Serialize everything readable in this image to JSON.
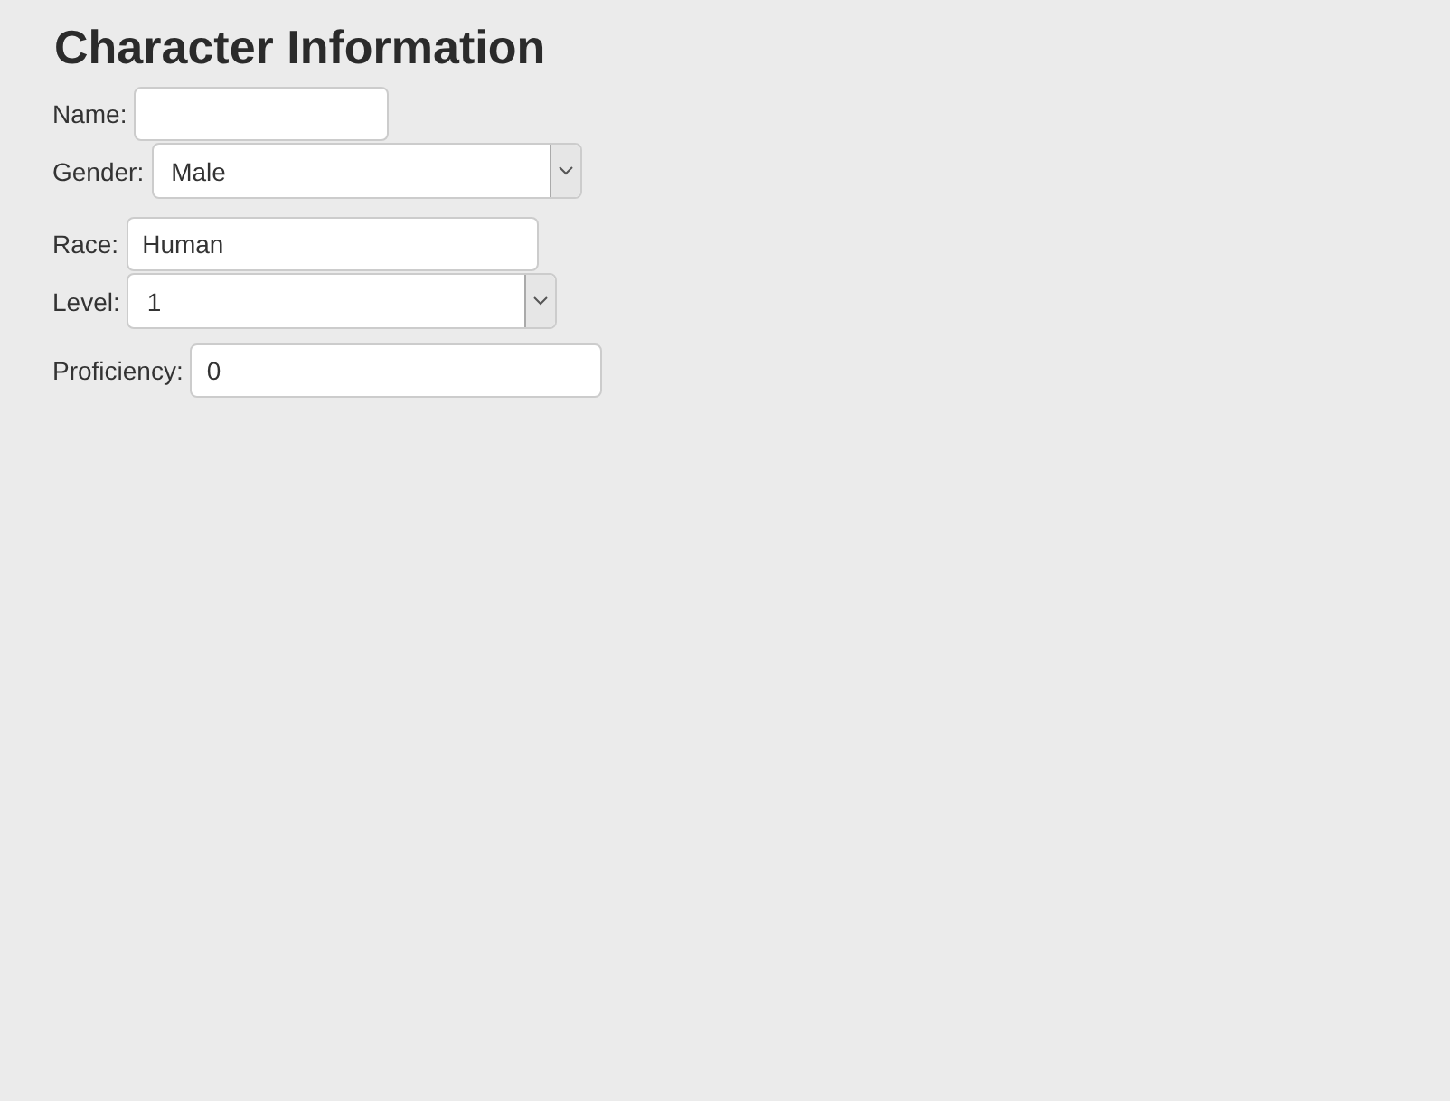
{
  "title": "Character Information",
  "fields": [
    {
      "kind": "text",
      "label": "Name:"
    },
    {
      "kind": "select",
      "label": "Gender:",
      "value": "Male"
    },
    {
      "kind": "text",
      "label": "Race:",
      "value": "Human"
    },
    {
      "kind": "select",
      "label": "Level:",
      "value": "1"
    },
    {
      "kind": "text",
      "label": "Proficiency:",
      "value": "0"
    }
  ]
}
